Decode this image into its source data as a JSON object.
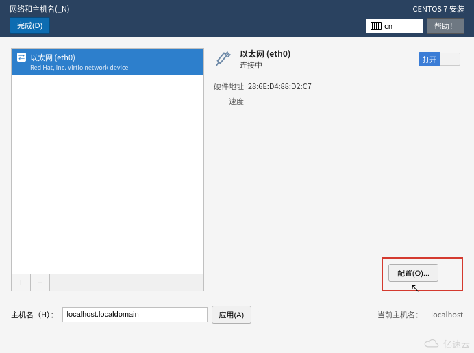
{
  "header": {
    "page_title": "网络和主机名(_N)",
    "done_button": "完成(D)",
    "installer_title": "CENTOS 7 安装",
    "language_code": "cn",
    "help_button": "帮助！"
  },
  "network_list": {
    "items": [
      {
        "name": "以太网 (eth0)",
        "description": "Red Hat, Inc. Virtio network device"
      }
    ],
    "add_btn": "+",
    "remove_btn": "−"
  },
  "connection": {
    "title": "以太网 (eth0)",
    "status": "连接中",
    "toggle_label": "打开",
    "details": {
      "hw_addr_label": "硬件地址",
      "hw_addr_value": "28:6E:D4:88:D2:C7",
      "speed_label": "速度",
      "speed_value": ""
    },
    "configure_button": "配置(O)..."
  },
  "hostname": {
    "label": "主机名（H）：",
    "value": "localhost.localdomain",
    "apply_button": "应用(A)",
    "current_label": "当前主机名：",
    "current_value": "localhost"
  },
  "watermark": "亿速云"
}
